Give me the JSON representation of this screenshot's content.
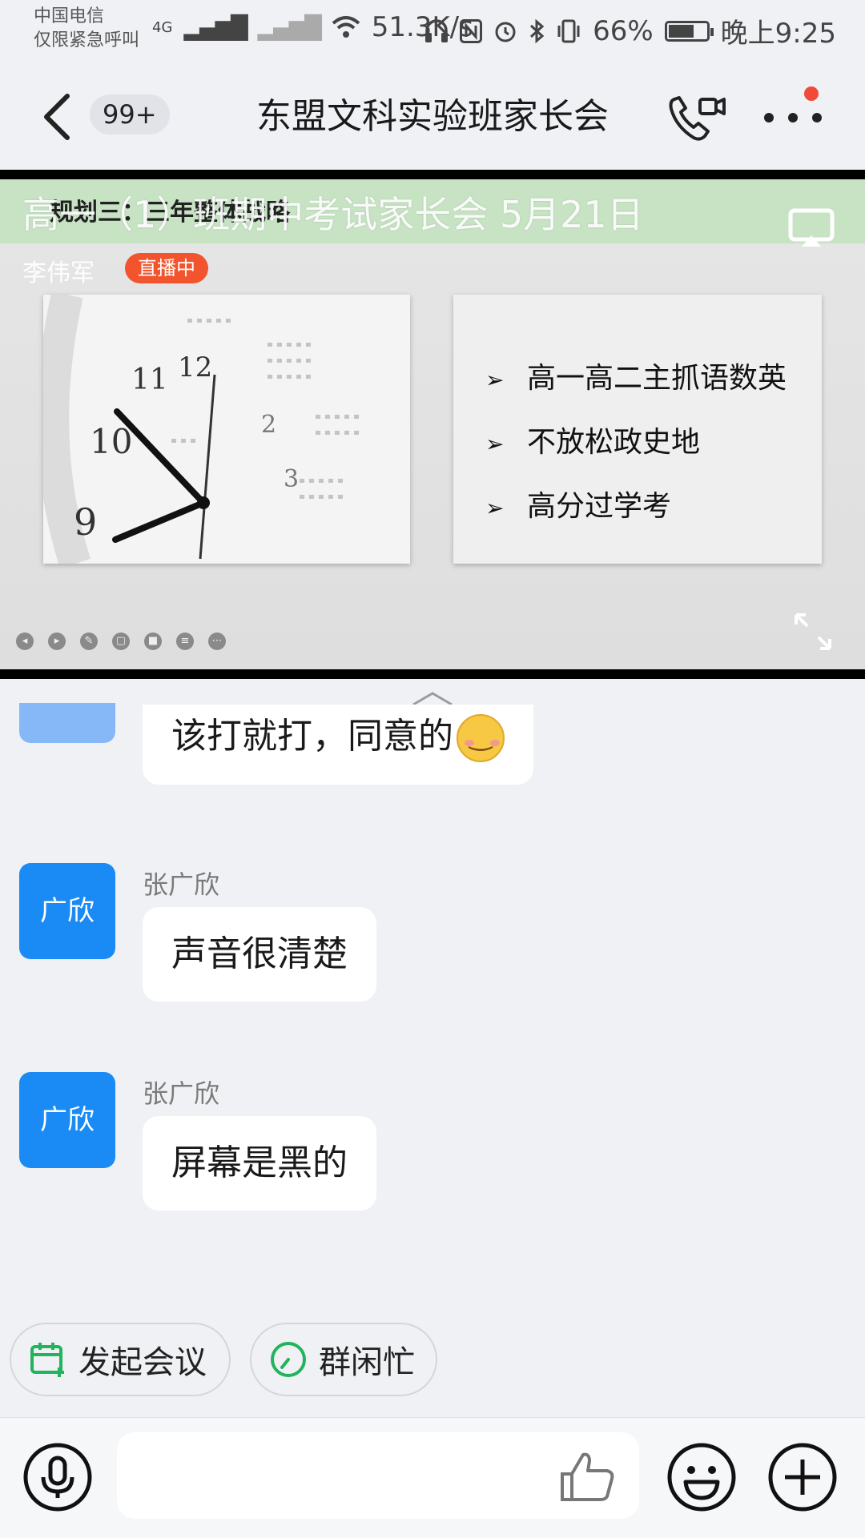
{
  "status_bar": {
    "carrier_line1": "中国电信",
    "carrier_line2": "仅限紧急呼叫",
    "network": "4G",
    "speed": "51.3K/s",
    "battery": "66%",
    "time": "晚上9:25"
  },
  "header": {
    "unread_badge": "99+",
    "title": "东盟文科实验班家长会"
  },
  "live": {
    "title": "高一（1）班期中考试家长会 5月21日",
    "host": "李伟军",
    "status_badge": "直播中",
    "slide_heading": "规划三：三年整体战略",
    "slide_bullets": [
      "高一高二主抓语数英",
      "不放松政史地",
      "高分过学考"
    ]
  },
  "messages": [
    {
      "text": "该打就打，同意的"
    },
    {
      "sender": "张广欣",
      "avatar_text": "广欣",
      "text": "声音很清楚"
    },
    {
      "sender": "张广欣",
      "avatar_text": "广欣",
      "text": "屏幕是黑的"
    }
  ],
  "actions": {
    "start_meeting": "发起会议",
    "group_availability": "群闲忙"
  },
  "colors": {
    "accent_blue": "#1a8af5",
    "live_red": "#f2542d",
    "action_green": "#22b35d"
  }
}
